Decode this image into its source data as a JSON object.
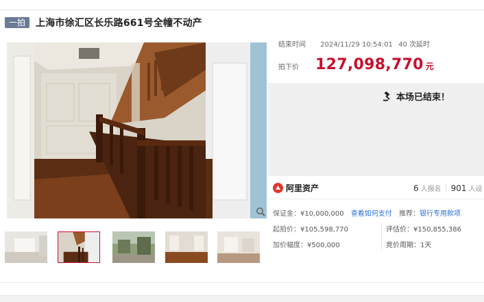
{
  "header": {
    "badge": "一拍",
    "title": "上海市徐汇区长乐路661号全幢不动产"
  },
  "auction": {
    "end_label": "结束时间",
    "end_time": "2024/11/29 10:54:01",
    "delay": "40 次延时",
    "price_label": "拍下价",
    "price": "127,098,770",
    "price_unit": "元",
    "ended_text": "本场已结束！"
  },
  "brand": {
    "name": "阿里资产",
    "registrants": "6",
    "registrants_label": "人报名",
    "watchers": "901",
    "watchers_label": "人设"
  },
  "details": {
    "deposit_label": "保证金：",
    "deposit": "¥10,000,000",
    "how_to_pay": "查看如何支付",
    "recommend_label": "推荐：",
    "recommend_link": "银行专用款项",
    "start_label": "起拍价：",
    "start": "¥105,598,770",
    "appraisal_label": "评估价：",
    "appraisal": "¥150,855,386",
    "increment_label": "加价幅度：",
    "increment": "¥500,000",
    "cycle_label": "竞价周期：",
    "cycle": "1天"
  },
  "colors": {
    "accent_red": "#c8102e",
    "badge_bg": "#6a7b97",
    "link_blue": "#2a6fd6",
    "brand_red": "#e1342e"
  },
  "icons": {
    "zoom": "magnifier-icon",
    "ended": "gavel-icon",
    "brand": "ali-assets-logo-icon"
  }
}
